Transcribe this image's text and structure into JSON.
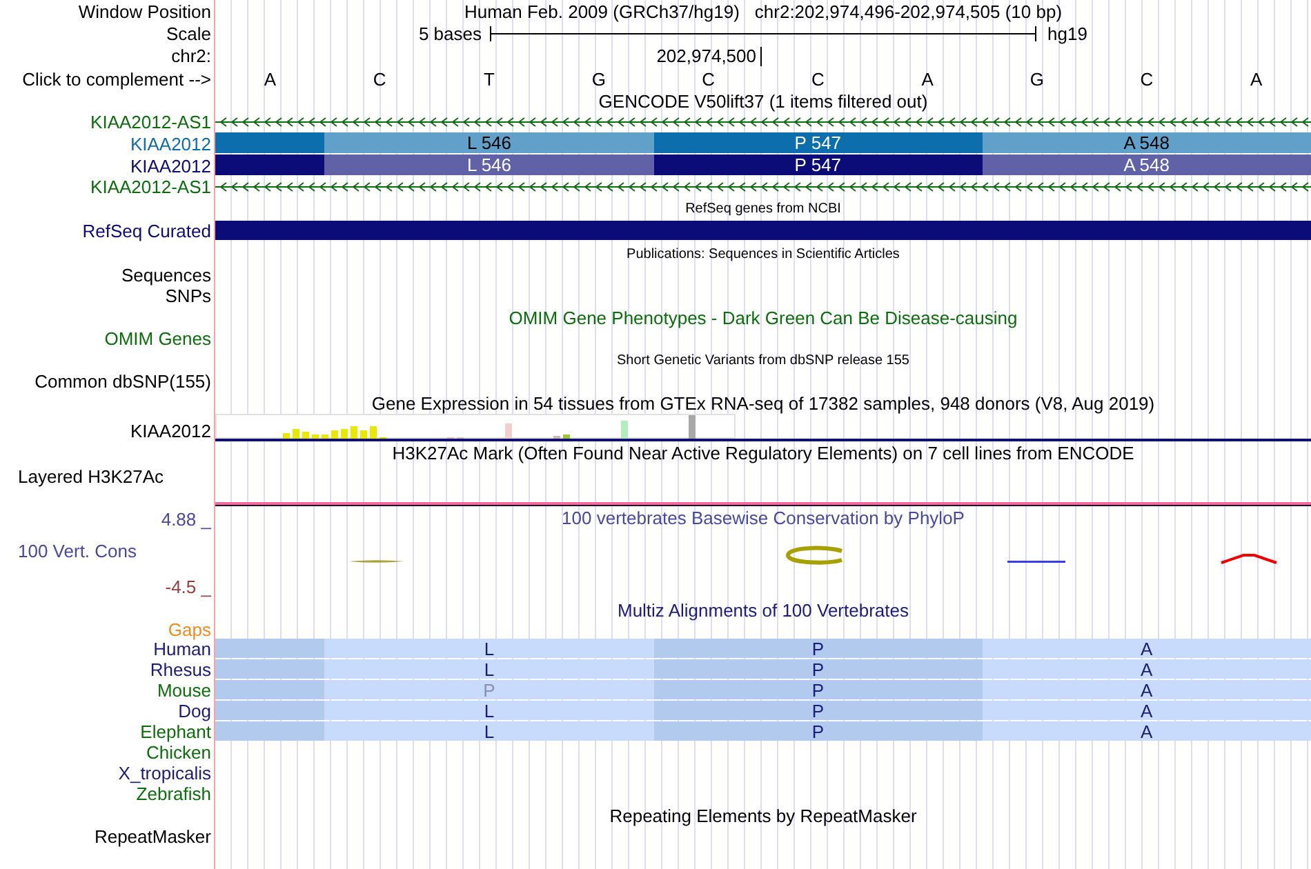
{
  "ruler": {
    "window_label": "Window Position",
    "assembly": "Human Feb. 2009 (GRCh37/hg19)",
    "position": "chr2:202,974,496-202,974,505 (10 bp)",
    "scale_label": "Scale",
    "scale_size": "5 bases",
    "database": "hg19",
    "chrom_label": "chr2:",
    "coordinate": "202,974,500",
    "bases_label": "Click to complement -->",
    "bases": [
      "A",
      "C",
      "T",
      "G",
      "C",
      "C",
      "A",
      "G",
      "C",
      "A"
    ]
  },
  "tracks": [
    {
      "kind": "gencode",
      "title": "GENCODE V50lift37 (1 items filtered out)",
      "color": "#000000",
      "items": [
        {
          "kind": "noncoding",
          "label": "KIAA2012-AS1",
          "color": "#0a6e0a"
        },
        {
          "kind": "coding",
          "label": "KIAA2012",
          "color": "#0c6eac",
          "codons": [
            "L 546",
            "P 547",
            "A 548"
          ]
        },
        {
          "kind": "coding",
          "label": "KIAA2012",
          "color": "#0c0c78",
          "codons": [
            "L 546",
            "P 547",
            "A 548"
          ]
        },
        {
          "kind": "noncoding",
          "label": "KIAA2012-AS1",
          "color": "#0a6e0a"
        }
      ]
    },
    {
      "kind": "refseq",
      "title": "RefSeq genes from NCBI",
      "color": "#000000",
      "items": [
        {
          "kind": "bar",
          "label": "RefSeq Curated",
          "color": "#0c0c78"
        }
      ]
    },
    {
      "kind": "publications",
      "title": "Publications: Sequences in Scientific Articles",
      "color": "#000000",
      "items": [
        {
          "kind": "empty",
          "label": "Sequences",
          "color": "#000000"
        },
        {
          "kind": "empty",
          "label": "SNPs",
          "color": "#000000"
        }
      ]
    },
    {
      "kind": "omim",
      "title": "OMIM Gene Phenotypes - Dark Green Can Be Disease-causing",
      "color": "#0a6e0a",
      "items": [
        {
          "kind": "empty",
          "label": "OMIM Genes",
          "color": "#0a6e0a"
        }
      ]
    },
    {
      "kind": "dbsnp",
      "title": "Short Genetic Variants from dbSNP release 155",
      "color": "#000000",
      "items": [
        {
          "kind": "empty",
          "label": "Common dbSNP(155)",
          "color": "#000000"
        }
      ]
    },
    {
      "kind": "gtex",
      "title": "Gene Expression in 54 tissues from GTEx RNA-seq of 17382 samples, 948 donors (V8, Aug 2019)",
      "color": "#000000",
      "items": [
        {
          "kind": "expression",
          "label": "KIAA2012",
          "color": "#000000"
        }
      ]
    },
    {
      "kind": "h3k27ac",
      "title": "H3K27Ac Mark (Often Found Near Active Regulatory Elements) on 7 cell lines from ENCODE",
      "color": "#000000",
      "items": [
        {
          "kind": "layered",
          "label": "Layered H3K27Ac",
          "color": "#000000"
        }
      ]
    },
    {
      "kind": "conservation",
      "title": "100 vertebrates Basewise Conservation by PhyloP",
      "color": "#4848a0",
      "scale": {
        "max": "4.88 _",
        "label": "100 Vert. Cons",
        "min": "-4.5 _"
      }
    },
    {
      "kind": "multiz",
      "title": "Multiz Alignments of 100 Vertebrates",
      "color": "#1b1b7c",
      "items": [
        {
          "kind": "gaps",
          "label": "Gaps",
          "color": "#f08c1c"
        },
        {
          "kind": "alignment",
          "label": "Human",
          "color": "#1b1b7c",
          "residues": [
            {
              "letter": "L",
              "matches": true
            },
            {
              "letter": "P",
              "matches": true
            },
            {
              "letter": "A",
              "matches": true
            }
          ]
        },
        {
          "kind": "alignment",
          "label": "Rhesus",
          "color": "#1b1b7c",
          "residues": [
            {
              "letter": "L",
              "matches": true
            },
            {
              "letter": "P",
              "matches": true
            },
            {
              "letter": "A",
              "matches": true
            }
          ]
        },
        {
          "kind": "alignment",
          "label": "Mouse",
          "color": "#0a6e0a",
          "residues": [
            {
              "letter": "P",
              "matches": false
            },
            {
              "letter": "P",
              "matches": true
            },
            {
              "letter": "A",
              "matches": true
            }
          ]
        },
        {
          "kind": "alignment",
          "label": "Dog",
          "color": "#1b1b7c",
          "residues": [
            {
              "letter": "L",
              "matches": true
            },
            {
              "letter": "P",
              "matches": true
            },
            {
              "letter": "A",
              "matches": true
            }
          ]
        },
        {
          "kind": "alignment",
          "label": "Elephant",
          "color": "#0a6e0a",
          "residues": [
            {
              "letter": "L",
              "matches": true
            },
            {
              "letter": "P",
              "matches": true
            },
            {
              "letter": "A",
              "matches": true
            }
          ]
        },
        {
          "kind": "empty",
          "label": "Chicken",
          "color": "#0a6e0a"
        },
        {
          "kind": "empty",
          "label": "X_tropicalis",
          "color": "#1b1b7c"
        },
        {
          "kind": "empty",
          "label": "Zebrafish",
          "color": "#0a6e0a"
        }
      ]
    },
    {
      "kind": "repeatmasker",
      "title": "Repeating Elements by RepeatMasker",
      "color": "#000000",
      "items": [
        {
          "kind": "empty",
          "label": "RepeatMasker",
          "color": "#000000"
        }
      ]
    }
  ]
}
